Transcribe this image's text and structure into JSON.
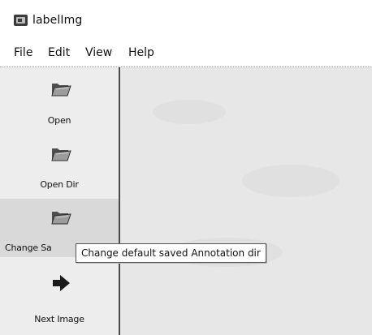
{
  "window": {
    "title": "labelImg",
    "app_icon": "labelimg-app-icon"
  },
  "menu": {
    "items": [
      {
        "label": "File"
      },
      {
        "label": "Edit"
      },
      {
        "label": "View"
      },
      {
        "label": "Help"
      }
    ]
  },
  "toolbar": {
    "items": [
      {
        "label": "Open",
        "icon": "folder-open-icon"
      },
      {
        "label": "Open Dir",
        "icon": "folder-open-icon"
      },
      {
        "label": "Change Sa",
        "icon": "folder-open-icon",
        "state": "hovered"
      },
      {
        "label": "Next Image",
        "icon": "arrow-right-icon"
      }
    ]
  },
  "tooltip": {
    "text": "Change default saved Annotation dir"
  },
  "colors": {
    "toolbar_bg": "#ededed",
    "toolbar_hover_bg": "#d9d9d9",
    "canvas_bg": "#e7e7e7",
    "folder_dark": "#4f4f4f",
    "folder_light": "#9c9c9c"
  }
}
